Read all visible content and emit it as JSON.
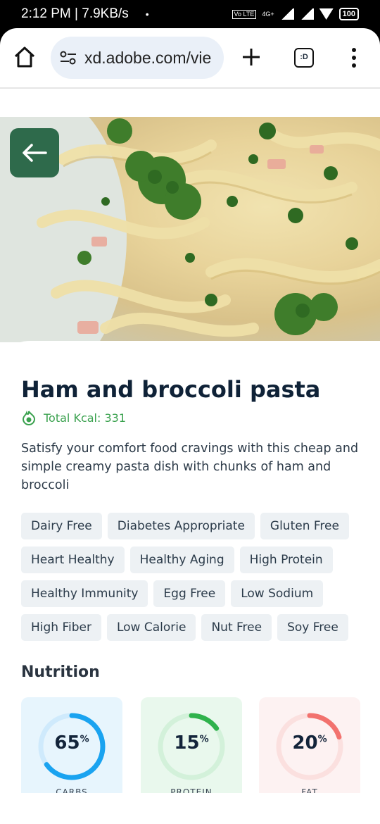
{
  "status": {
    "time_speed": "2:12 PM | 7.9KB/s",
    "dot": "•",
    "lte": "Vo LTE",
    "network": "4G+",
    "battery": "100"
  },
  "browser": {
    "url": "xd.adobe.com/vie",
    "tabs_label": ":D"
  },
  "recipe": {
    "title": "Ham and broccoli pasta",
    "kcal": "Total Kcal: 331",
    "description": "Satisfy your comfort food cravings with this cheap and simple creamy pasta dish with chunks of ham and broccoli",
    "tags": [
      "Dairy Free",
      "Diabetes Appropriate",
      "Gluten Free",
      "Heart Healthy",
      "Healthy Aging",
      "High Protein",
      "Healthy Immunity",
      "Egg Free",
      "Low Sodium",
      "High Fiber",
      "Low Calorie",
      "Nut Free",
      "Soy Free"
    ]
  },
  "nutrition": {
    "title": "Nutrition",
    "items": [
      {
        "value": "65",
        "unit": "%",
        "label": "CARBS",
        "fraction": 0.65,
        "color": "#1aa3f0",
        "track": "#cfeafc",
        "bg": "#e7f5fd"
      },
      {
        "value": "15",
        "unit": "%",
        "label": "PROTEIN",
        "fraction": 0.15,
        "color": "#2fb24c",
        "track": "#d3f1da",
        "bg": "#e9f8ed"
      },
      {
        "value": "20",
        "unit": "%",
        "label": "FAT",
        "fraction": 0.2,
        "color": "#f2726e",
        "track": "#fbe0df",
        "bg": "#fdf2f2"
      }
    ]
  },
  "colors": {
    "accent_green": "#2e6a4b",
    "kcal_green": "#3aa14e"
  }
}
